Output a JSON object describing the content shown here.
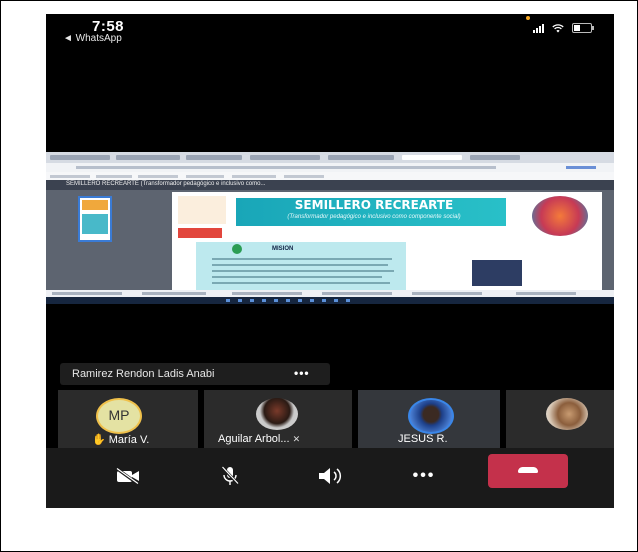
{
  "status_bar": {
    "time": "7:58",
    "back_label": "◄ WhatsApp"
  },
  "shared_screen": {
    "document_title": "SEMILLERO RECREARTE",
    "document_subtitle": "(Transformador pedagógico e inclusivo como componente social)",
    "section_heading": "MISION",
    "toolbar_title": "SEMILLERO RECREARTE (Transformador pedagógico e inclusivo como..."
  },
  "name_bar": {
    "name": "Ramirez Rendon Ladis Anabi",
    "more_label": "•••"
  },
  "participants": [
    {
      "name": "María V.",
      "initials": "MP",
      "hand_raised": true
    },
    {
      "name": "Aguilar Arbol...",
      "muted": true
    },
    {
      "name": "JESUS R.",
      "active": true
    },
    {
      "name": ""
    }
  ],
  "controls": {
    "camera": "camera-off-icon",
    "mic": "mic-off-icon",
    "speaker": "speaker-icon",
    "more_label": "•••",
    "hangup": "hang-up-icon"
  },
  "colors": {
    "hangup": "#c4314b",
    "hand": "#f5b82e",
    "banner": "#19a6b8"
  }
}
